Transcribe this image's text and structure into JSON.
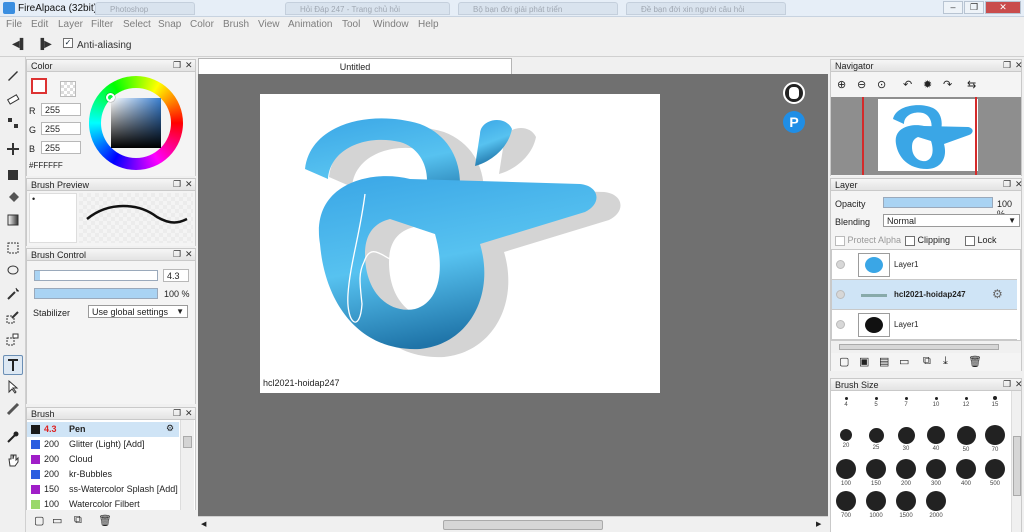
{
  "app": {
    "title": "FireAlpaca (32bit)",
    "ghost_tabs": [
      "Photoshop",
      "Hỏi Đáp 247 - Trang chủ hỏi",
      "Bộ bạn đời giải phát triển",
      "Đề bạn đời xin người câu hỏi"
    ],
    "window_buttons": [
      "–",
      "❐",
      "✕"
    ]
  },
  "menu": [
    "File",
    "Edit",
    "Layer",
    "Filter",
    "Select",
    "Snap",
    "Color",
    "Brush",
    "View",
    "Animation",
    "Tool",
    "Window",
    "Help"
  ],
  "toolbar": {
    "prev_icon": "◀▌",
    "next_icon": "▐▶",
    "anti_aliasing_label": "Anti-aliasing",
    "anti_aliasing_checked": true
  },
  "color_panel": {
    "title": "Color",
    "r_label": "R",
    "g_label": "G",
    "b_label": "B",
    "r": "255",
    "g": "255",
    "b": "255",
    "hex": "#FFFFFF"
  },
  "brush_preview": {
    "title": "Brush Preview",
    "dot": "•"
  },
  "brush_control": {
    "title": "Brush Control",
    "size": "4.3",
    "opacity": "100 %",
    "size_fraction": 0.04,
    "opacity_fraction": 1.0,
    "stabilizer_label": "Stabilizer",
    "stabilizer_value": "Use global settings"
  },
  "brush_panel": {
    "title": "Brush",
    "items": [
      {
        "size": "4.3",
        "name": "Pen",
        "color": "#1a1a1a",
        "selected": true
      },
      {
        "size": "200",
        "name": "Glitter (Light) [Add]",
        "color": "#2a5de0"
      },
      {
        "size": "200",
        "name": "Cloud",
        "color": "#a01ec8"
      },
      {
        "size": "200",
        "name": "kr-Bubbles",
        "color": "#2a5de0"
      },
      {
        "size": "150",
        "name": "ss-Watercolor Splash [Add]",
        "color": "#a01ec8"
      },
      {
        "size": "100",
        "name": "Watercolor Filbert",
        "color": "#9ad86a"
      }
    ]
  },
  "document": {
    "tab_title": "Untitled",
    "canvas_text": "hcl2021-hoidap247"
  },
  "navigator": {
    "title": "Navigator",
    "icons": [
      "⊕",
      "⊖",
      "⊙",
      "↶",
      "✹",
      "↷",
      "⇆"
    ]
  },
  "layer_panel": {
    "title": "Layer",
    "opacity_label": "Opacity",
    "opacity_value": "100 %",
    "opacity_fraction": 1.0,
    "blending_label": "Blending",
    "blending_value": "Normal",
    "protect_alpha": "Protect Alpha",
    "clipping": "Clipping",
    "lock": "Lock",
    "layers": [
      {
        "name": "Layer1",
        "selected": false
      },
      {
        "name": "hcl2021-hoidap247",
        "selected": true
      },
      {
        "name": "Layer1",
        "selected": false
      }
    ]
  },
  "brush_size_panel": {
    "title": "Brush Size",
    "sizes": [
      "4",
      "5",
      "7",
      "10",
      "12",
      "15",
      "20",
      "25",
      "30",
      "40",
      "50",
      "70",
      "100",
      "150",
      "200",
      "300",
      "400",
      "500",
      "700",
      "1000",
      "1500",
      "2000"
    ]
  },
  "panel_buttons": {
    "float": "❐",
    "close": "✕"
  },
  "colors": {
    "accent": "#3aa6e6",
    "workspace": "#707070",
    "selection": "#cfe4f6"
  }
}
